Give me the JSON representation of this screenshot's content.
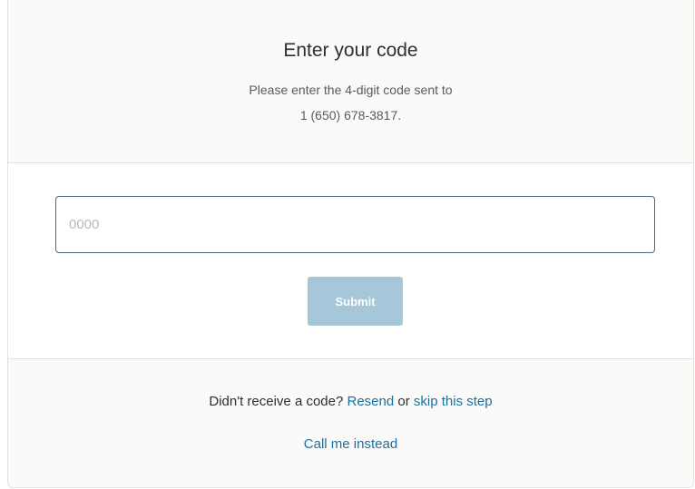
{
  "header": {
    "title": "Enter your code",
    "subtitle_line1": "Please enter the 4-digit code sent to",
    "subtitle_line2": "1 (650) 678-3817."
  },
  "form": {
    "code_placeholder": "0000",
    "code_value": "",
    "submit_label": "Submit",
    "colors": {
      "input_border": "#3e6d8e",
      "submit_bg": "#a6c7d9"
    }
  },
  "footer": {
    "prompt": "Didn't receive a code?",
    "resend_label": "Resend",
    "or_text": "or",
    "skip_label": "skip this step",
    "call_label": "Call me instead",
    "link_color": "#1d6f9e"
  }
}
